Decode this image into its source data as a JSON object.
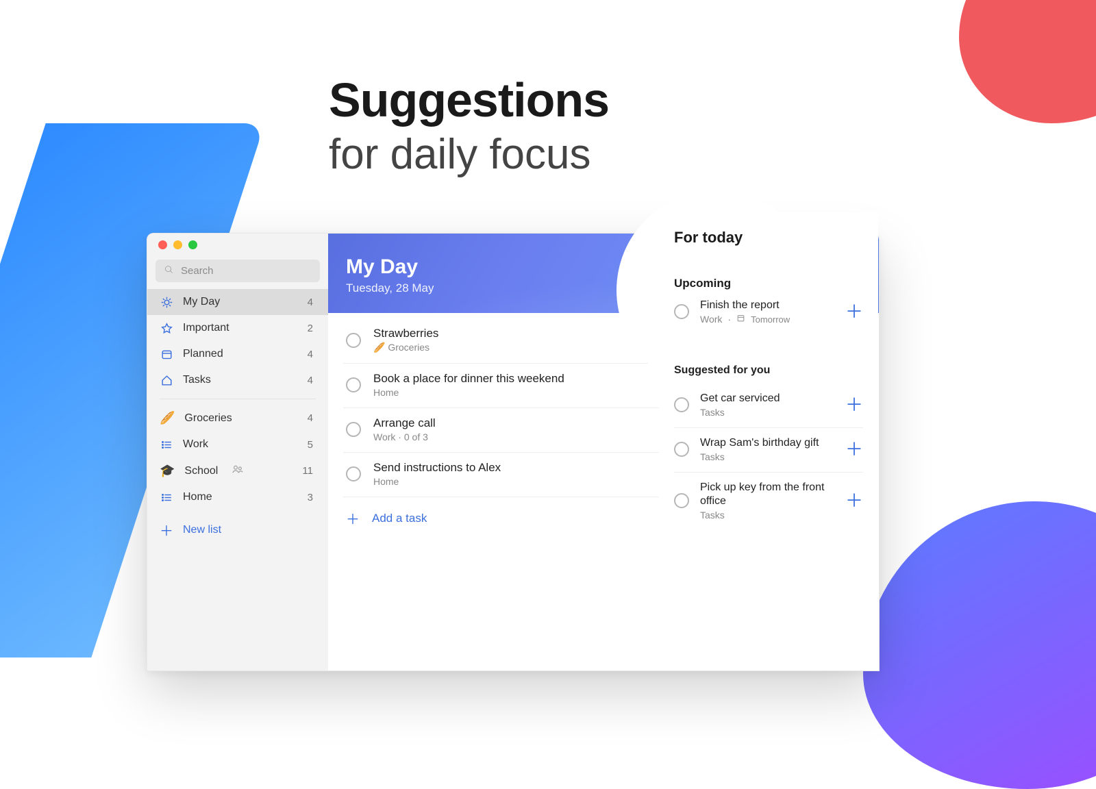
{
  "hero": {
    "line1": "Suggestions",
    "line2": "for daily focus"
  },
  "search": {
    "placeholder": "Search"
  },
  "sidebar": {
    "smart": [
      {
        "icon": "sun",
        "label": "My Day",
        "count": 4,
        "active": true
      },
      {
        "icon": "star",
        "label": "Important",
        "count": 2
      },
      {
        "icon": "calendar",
        "label": "Planned",
        "count": 4
      },
      {
        "icon": "home",
        "label": "Tasks",
        "count": 4
      }
    ],
    "lists": [
      {
        "emoji": "🥖",
        "label": "Groceries",
        "count": 4
      },
      {
        "icon": "bullets",
        "label": "Work",
        "count": 5,
        "color": "#3b6fde"
      },
      {
        "emoji": "🎓",
        "label": "School",
        "count": 11,
        "shared": true
      },
      {
        "icon": "bullets",
        "label": "Home",
        "count": 3,
        "color": "#1aa06a"
      }
    ],
    "new_list": "New list"
  },
  "header": {
    "title": "My Day",
    "subtitle": "Tuesday, 28 May"
  },
  "tasks": [
    {
      "title": "Strawberries",
      "meta": "🥖 Groceries"
    },
    {
      "title": "Book a place for dinner this weekend",
      "meta": "Home"
    },
    {
      "title": "Arrange call",
      "meta": "Work  ·  0 of 3"
    },
    {
      "title": "Send instructions to Alex",
      "meta": "Home"
    }
  ],
  "add_task": "Add a task",
  "panel": {
    "title": "For today",
    "upcoming_label": "Upcoming",
    "upcoming": {
      "title": "Finish the report",
      "list": "Work",
      "due": "Tomorrow"
    },
    "suggested_label": "Suggested for you",
    "suggested": [
      {
        "title": "Get car serviced",
        "list": "Tasks"
      },
      {
        "title": "Wrap Sam's birthday gift",
        "list": "Tasks"
      },
      {
        "title": "Pick up key from the front office",
        "list": "Tasks"
      }
    ]
  }
}
